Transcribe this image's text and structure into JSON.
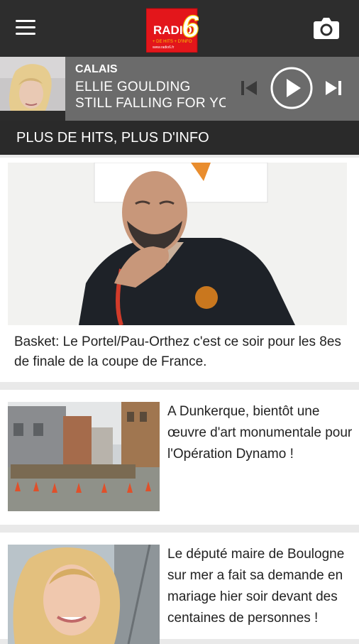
{
  "header": {
    "logo_text": "RADIO",
    "logo_number": "6",
    "logo_tagline": "+ DE HITS + D'INFO",
    "logo_url": "www.radio6.fr",
    "menu_icon": "hamburger-menu-icon",
    "camera_icon": "camera-icon"
  },
  "player": {
    "station": "CALAIS",
    "artist": "ELLIE GOULDING",
    "track": "STILL FALLING FOR YOU",
    "controls": [
      "skip-previous-icon",
      "play-icon",
      "skip-next-icon"
    ]
  },
  "section": {
    "title": "PLUS DE HITS, PLUS D'INFO"
  },
  "articles": [
    {
      "caption": "Basket: Le Portel/Pau-Orthez c'est ce soir pour les 8es de finale de la coupe de France."
    },
    {
      "caption": "A Dunkerque, bientôt une œuvre d'art monumentale pour l'Opération Dynamo !"
    },
    {
      "caption": "Le député maire de Boulogne sur mer a fait sa demande en mariage hier soir devant des centaines de personnes !"
    }
  ],
  "colors": {
    "topbar": "#2d2d2d",
    "player_bg": "#6b6b6b",
    "section_bg": "#2a2a2a",
    "logo_red": "#e3161b",
    "logo_yellow": "#f5c400"
  }
}
